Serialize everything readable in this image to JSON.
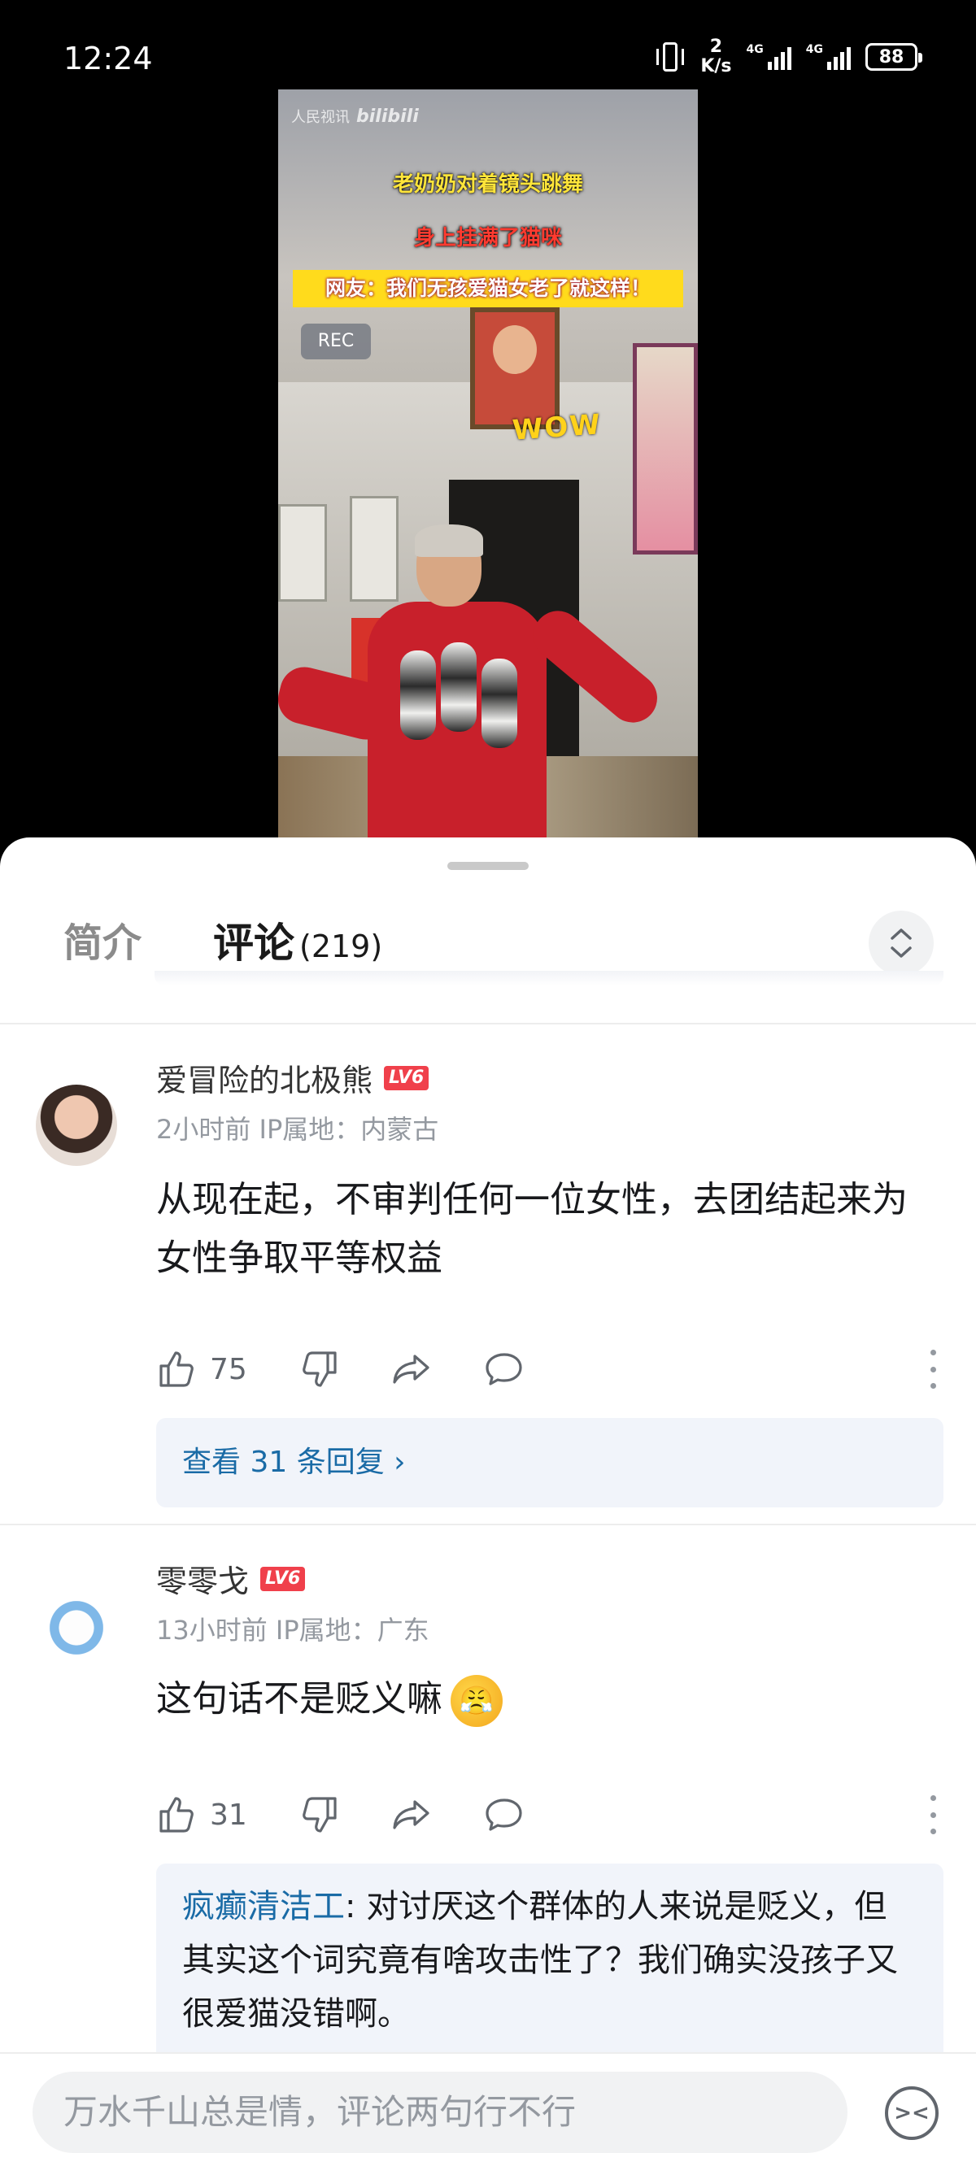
{
  "status_bar": {
    "time": "12:24",
    "speed_value": "2",
    "speed_unit": "K/s",
    "network1": "4G",
    "network2": "4G",
    "battery": "88"
  },
  "video": {
    "watermark_source": "人民视讯",
    "watermark_brand": "bilibili",
    "caption_line1": "老奶奶对着镜头跳舞",
    "caption_line2": "身上挂满了猫咪",
    "caption_line3": "网友：我们无孩爱猫女老了就这样！",
    "rec_label": "REC",
    "sticker": "WOW"
  },
  "tabs": {
    "intro": "简介",
    "comments": "评论",
    "comments_count": "(219)",
    "accent": "#fb7299"
  },
  "comments": [
    {
      "username": "爱冒险的北极熊",
      "level": "LV6",
      "time": "2小时前",
      "ip": "IP属地：内蒙古",
      "text": "从现在起，不审判任何一位女性，去团结起来为女性争取平等权益",
      "likes": "75",
      "view_replies": "查看 31 条回复 ›"
    },
    {
      "username": "零零戈",
      "level": "LV6",
      "time": "13小时前",
      "ip": "IP属地：广东",
      "text": "这句话不是贬义嘛",
      "likes": "31",
      "reply_author": "疯癫清洁工",
      "reply_text": ": 对讨厌这个群体的人来说是贬义，但其实这个词究竟有啥攻击性了？我们确实没孩子又很爱猫没错啊。"
    }
  ],
  "input": {
    "placeholder": "万水千山总是情，评论两句行不行"
  }
}
